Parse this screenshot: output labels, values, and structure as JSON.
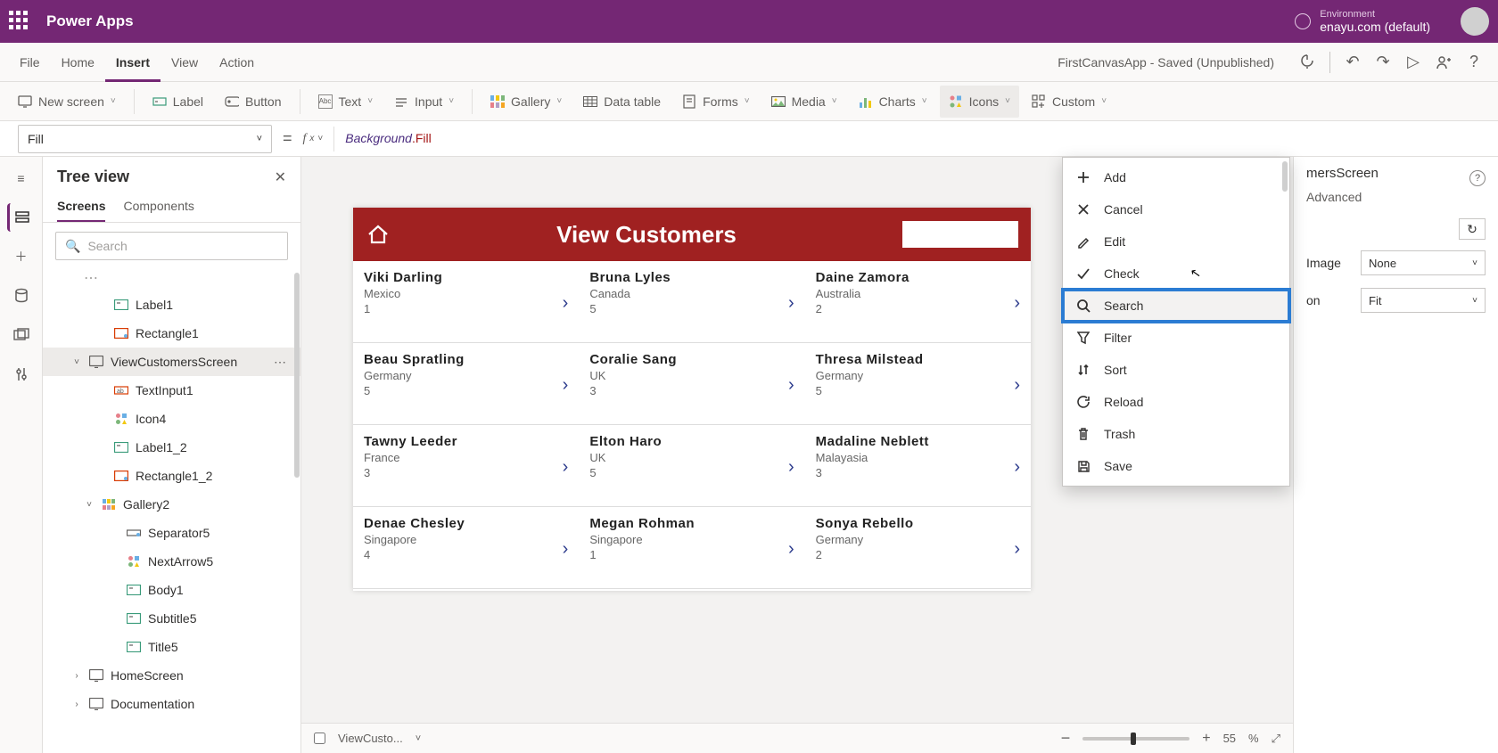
{
  "brand": "Power Apps",
  "environment": {
    "label": "Environment",
    "name": "enayu.com (default)"
  },
  "menu": {
    "file": "File",
    "home": "Home",
    "insert": "Insert",
    "view": "View",
    "action": "Action"
  },
  "appinfo": "FirstCanvasApp - Saved (Unpublished)",
  "tools": {
    "newscreen": "New screen",
    "label": "Label",
    "button": "Button",
    "text": "Text",
    "input": "Input",
    "gallery": "Gallery",
    "datatable": "Data table",
    "forms": "Forms",
    "media": "Media",
    "charts": "Charts",
    "icons": "Icons",
    "custom": "Custom"
  },
  "prop_selected": "Fill",
  "formula_obj": "Background",
  "formula_prop": ".Fill",
  "tree": {
    "title": "Tree view",
    "tab_screens": "Screens",
    "tab_components": "Components",
    "search_placeholder": "Search",
    "items": [
      {
        "name": "Label1",
        "indent": 60,
        "icon": "label"
      },
      {
        "name": "Rectangle1",
        "indent": 60,
        "icon": "rect"
      },
      {
        "name": "ViewCustomersScreen",
        "indent": 32,
        "icon": "screen",
        "sel": true,
        "caret": "˅",
        "ell": true
      },
      {
        "name": "TextInput1",
        "indent": 60,
        "icon": "input"
      },
      {
        "name": "Icon4",
        "indent": 60,
        "icon": "icons"
      },
      {
        "name": "Label1_2",
        "indent": 60,
        "icon": "label"
      },
      {
        "name": "Rectangle1_2",
        "indent": 60,
        "icon": "rect"
      },
      {
        "name": "Gallery2",
        "indent": 46,
        "icon": "gallery",
        "caret": "˅"
      },
      {
        "name": "Separator5",
        "indent": 74,
        "icon": "sep"
      },
      {
        "name": "NextArrow5",
        "indent": 74,
        "icon": "icons"
      },
      {
        "name": "Body1",
        "indent": 74,
        "icon": "label"
      },
      {
        "name": "Subtitle5",
        "indent": 74,
        "icon": "label"
      },
      {
        "name": "Title5",
        "indent": 74,
        "icon": "label"
      },
      {
        "name": "HomeScreen",
        "indent": 32,
        "icon": "screen",
        "caret": "›"
      },
      {
        "name": "Documentation",
        "indent": 32,
        "icon": "screen",
        "caret": "›"
      }
    ]
  },
  "icon_menu": {
    "items": [
      {
        "label": "Add",
        "icon": "plus"
      },
      {
        "label": "Cancel",
        "icon": "x"
      },
      {
        "label": "Edit",
        "icon": "pencil"
      },
      {
        "label": "Check",
        "icon": "check"
      },
      {
        "label": "Search",
        "icon": "search",
        "highlight": true
      },
      {
        "label": "Filter",
        "icon": "filter"
      },
      {
        "label": "Sort",
        "icon": "sort"
      },
      {
        "label": "Reload",
        "icon": "reload"
      },
      {
        "label": "Trash",
        "icon": "trash"
      },
      {
        "label": "Save",
        "icon": "save"
      }
    ]
  },
  "app": {
    "title": "View Customers",
    "customers": [
      {
        "name": "Viki  Darling",
        "country": "Mexico",
        "num": "1"
      },
      {
        "name": "Bruna  Lyles",
        "country": "Canada",
        "num": "5"
      },
      {
        "name": "Daine  Zamora",
        "country": "Australia",
        "num": "2"
      },
      {
        "name": "Beau  Spratling",
        "country": "Germany",
        "num": "5"
      },
      {
        "name": "Coralie  Sang",
        "country": "UK",
        "num": "3"
      },
      {
        "name": "Thresa  Milstead",
        "country": "Germany",
        "num": "5"
      },
      {
        "name": "Tawny  Leeder",
        "country": "France",
        "num": "3"
      },
      {
        "name": "Elton  Haro",
        "country": "UK",
        "num": "5"
      },
      {
        "name": "Madaline  Neblett",
        "country": "Malayasia",
        "num": "3"
      },
      {
        "name": "Denae  Chesley",
        "country": "Singapore",
        "num": "4"
      },
      {
        "name": "Megan  Rohman",
        "country": "Singapore",
        "num": "1"
      },
      {
        "name": "Sonya  Rebello",
        "country": "Germany",
        "num": "2"
      }
    ]
  },
  "status": {
    "crumb": "ViewCusto...",
    "zoom": "55",
    "pct": "%"
  },
  "right": {
    "heading": "mersScreen",
    "tab": "Advanced",
    "image_lbl": "Image",
    "image_val": "None",
    "pos_lbl": "on",
    "pos_val": "Fit"
  }
}
